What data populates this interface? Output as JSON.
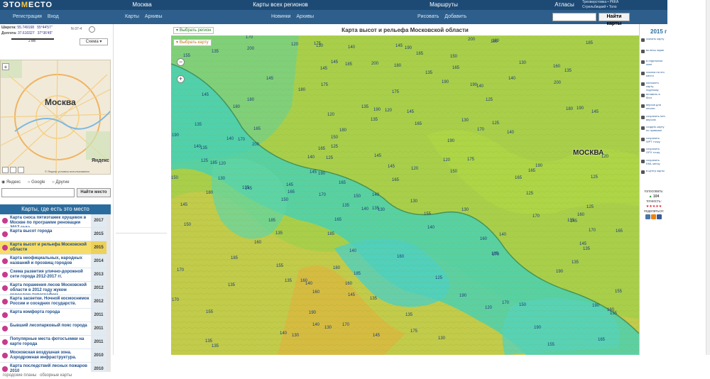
{
  "header": {
    "logo": {
      "before": "ЭТО",
      "m": "М",
      "after": "ЕСТО"
    },
    "sections": [
      "Москва",
      "Карты всех регионов",
      "Маршруты",
      "Атласы"
    ],
    "register_label": "Регистрация",
    "login_label": "Вход",
    "moscow_sub": [
      "Карты",
      "Архивы"
    ],
    "regions_sub": [
      "Новинки",
      "Архивы"
    ],
    "routes_sub": [
      "Рисовать",
      "Добавить"
    ],
    "atlas_links": [
      "Трехверстовка • РККА",
      "Стрельбицкий • Топо"
    ],
    "search_placeholder": "",
    "search_button": "Найти карты"
  },
  "left_panel": {
    "lat_label": "Широта:",
    "lat_value": "55.749168",
    "lat_dms": "55°44'57\"",
    "lon_label": "Долгота:",
    "lon_value": "37.610327",
    "lon_dms": "37°36'45\"",
    "grid_ref": "N-37-4",
    "scale_label": "2 км",
    "map_type_label": "Схема",
    "mini_map_city": "Москва",
    "copyright": "© Яндекс условия использования",
    "yandex_brand": "Яндекс",
    "search_engines": [
      "Яндекс",
      "Google",
      "Другие"
    ],
    "place_search_placeholder": "",
    "place_search_button": "Найти место",
    "list_title": "Карты, где есть это место",
    "maps_list": [
      {
        "title": "Карта сноса пятиэтажек хрущевок в Москве по программе реновации 2017 года",
        "year": "2017"
      },
      {
        "title": "Карта высот города",
        "year": "2015"
      },
      {
        "title": "Карта высот и рельефа Московской области",
        "year": "2015",
        "selected": true
      },
      {
        "title": "Карта неофициальных, народных названий и прозвищ городов",
        "year": "2014"
      },
      {
        "title": "Схема развития улично-дорожной сети города 2012-2017 гг.",
        "year": "2013"
      },
      {
        "title": "Карта поражения лесов Московской области в 2012 году жуком короедом-типографом",
        "year": "2012"
      },
      {
        "title": "Карта засветки. Ночной космоснимок России и соседних государств.",
        "year": "2012"
      },
      {
        "title": "Карта комфорта города",
        "year": "2011"
      },
      {
        "title": "Бывший лесопарковый пояс города",
        "year": "2011"
      },
      {
        "title": "Популярные места фотосъемки на карте города",
        "year": "2011"
      },
      {
        "title": "Московская воздушная зона. Аэродромная инфраструктура.",
        "year": "2010"
      },
      {
        "title": "Карта последствий лесных пожаров 2010",
        "year": "2010"
      }
    ],
    "footer_links": [
      "городские планы",
      "обзорные карты"
    ]
  },
  "map": {
    "title": "Карта высот и рельефа Московской области",
    "select_region_label": "Выбрать регион",
    "select_map_label": "Выбрать карту",
    "city_label": "МОСКВА",
    "zoom_in": "+",
    "zoom_out": "−",
    "elevation_labels": [
      "165",
      "145",
      "170",
      "140",
      "150",
      "155",
      "160",
      "135",
      "175",
      "185",
      "180",
      "130",
      "125",
      "200",
      "120",
      "190"
    ]
  },
  "right_panel": {
    "year": "2015 г",
    "tools": [
      "скачать карту",
      "во весь экран",
      "в отдельном окне",
      "ссылка на это место",
      "наложить карту-подложку",
      "вставить в блог",
      "версия для печати",
      "сохранить kml-версию",
      "создать карту по привязке",
      "сохранить WPT точку",
      "сохранить GPX точку",
      "сохранить KML метку",
      "в центр карты"
    ],
    "vote_label": "голосовать:",
    "vote_count": "104",
    "accuracy_label": "точность:",
    "share_label": "поделиться:"
  },
  "colors": {
    "nav_dark": "#1d4a75",
    "nav_light": "#2e5f8c",
    "list_header": "#2b6c9e",
    "selected_item": "#f6dd6a",
    "map_green": "#b9d64a",
    "map_cyan": "#3fd1b6"
  }
}
